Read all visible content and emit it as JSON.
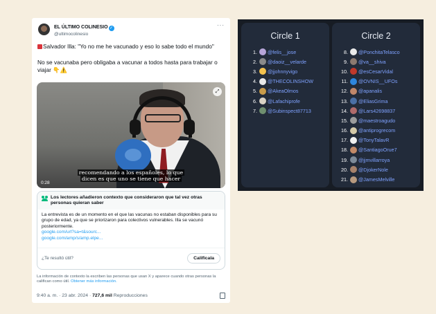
{
  "tweet": {
    "display_name": "EL ÚLTIMO COLINESIO",
    "verified_glyph": "✓",
    "handle": "@ultimocolinesio",
    "more_glyph": "···",
    "text_line1": "Salvador Illa: \"Yo no me he vacunado y eso lo sabe todo el mundo\"",
    "text_line2": "No se vacunaba pero obligaba a vacunar a todos hasta para trabajar o viajar 👇⚠️",
    "video": {
      "subtitle_line1": "recomendando a los españoles, lo que",
      "subtitle_line2": "dicen es que uno se tiene que hacer",
      "time": "0:28",
      "expand_glyph": "⤢"
    },
    "context": {
      "title": "Los lectores añadieron contexto que consideraron que tal vez otras personas quieran saber",
      "body": "La entrevista  es de un momento en el que las vacunas no estaban disponibles para su grupo de edad, ya que se priorizaron para colectivos vulnerables. Illa se vacunó posteriormente.",
      "link1": "google.com/url?sa=t&sourc...",
      "link2": "google.com/amp/s/amp.elpe...",
      "question": "¿Te resultó útil?",
      "rate_button": "Califícala"
    },
    "info_text": "La información de contexto la escriben las personas que usan X y aparece cuando otras personas la califican como útil.",
    "info_link": "Obtener más información.",
    "time": "9:40 a. m. · 23 abr. 2024 ·",
    "views": "727,6 mil",
    "views_label": "Reproducciones"
  },
  "circles": [
    {
      "title": "Circle 1",
      "members": [
        {
          "rank": "1.",
          "handle": "@felis__jose",
          "color": "#b7a5d8"
        },
        {
          "rank": "2.",
          "handle": "@daoiz__velarde",
          "color": "#8a8a8a"
        },
        {
          "rank": "3.",
          "handle": "@jjohnnyvigo",
          "color": "#f2c14e"
        },
        {
          "rank": "4.",
          "handle": "@THECOLINSHOW",
          "color": "#e8e8e8"
        },
        {
          "rank": "5.",
          "handle": "@AkeaOlmos",
          "color": "#c89b4a"
        },
        {
          "rank": "6.",
          "handle": "@Lafachiprofe",
          "color": "#d9d2c5"
        },
        {
          "rank": "7.",
          "handle": "@Subinspect87713",
          "color": "#6f8f6f"
        }
      ]
    },
    {
      "title": "Circle 2",
      "members": [
        {
          "rank": "8.",
          "handle": "@PonchitaTelasco",
          "color": "#eaeaea"
        },
        {
          "rank": "9.",
          "handle": "@va__shiva",
          "color": "#8c7a70"
        },
        {
          "rank": "10.",
          "handle": "@esCesarVidal",
          "color": "#c0392b"
        },
        {
          "rank": "11.",
          "handle": "@OVNIS__UFOs",
          "color": "#2e86de"
        },
        {
          "rank": "12.",
          "handle": "@apanalis",
          "color": "#c0876a"
        },
        {
          "rank": "13.",
          "handle": "@EliasGrima",
          "color": "#4a6fa5"
        },
        {
          "rank": "14.",
          "handle": "@Lars42698837",
          "color": "#b06b6b"
        },
        {
          "rank": "15.",
          "handle": "@maestroagudo",
          "color": "#9c9c9c"
        },
        {
          "rank": "16.",
          "handle": "@antiprogrecom",
          "color": "#d4c9a8"
        },
        {
          "rank": "17.",
          "handle": "@TonyTalavR",
          "color": "#f0f0f0"
        },
        {
          "rank": "18.",
          "handle": "@SantiagoOrue7",
          "color": "#c28a68"
        },
        {
          "rank": "19.",
          "handle": "@jjmvillarroya",
          "color": "#7d8b99"
        },
        {
          "rank": "20.",
          "handle": "@DjokerNole",
          "color": "#a7826b"
        },
        {
          "rank": "21.",
          "handle": "@JamesMelville",
          "color": "#b89a7f"
        }
      ]
    }
  ]
}
